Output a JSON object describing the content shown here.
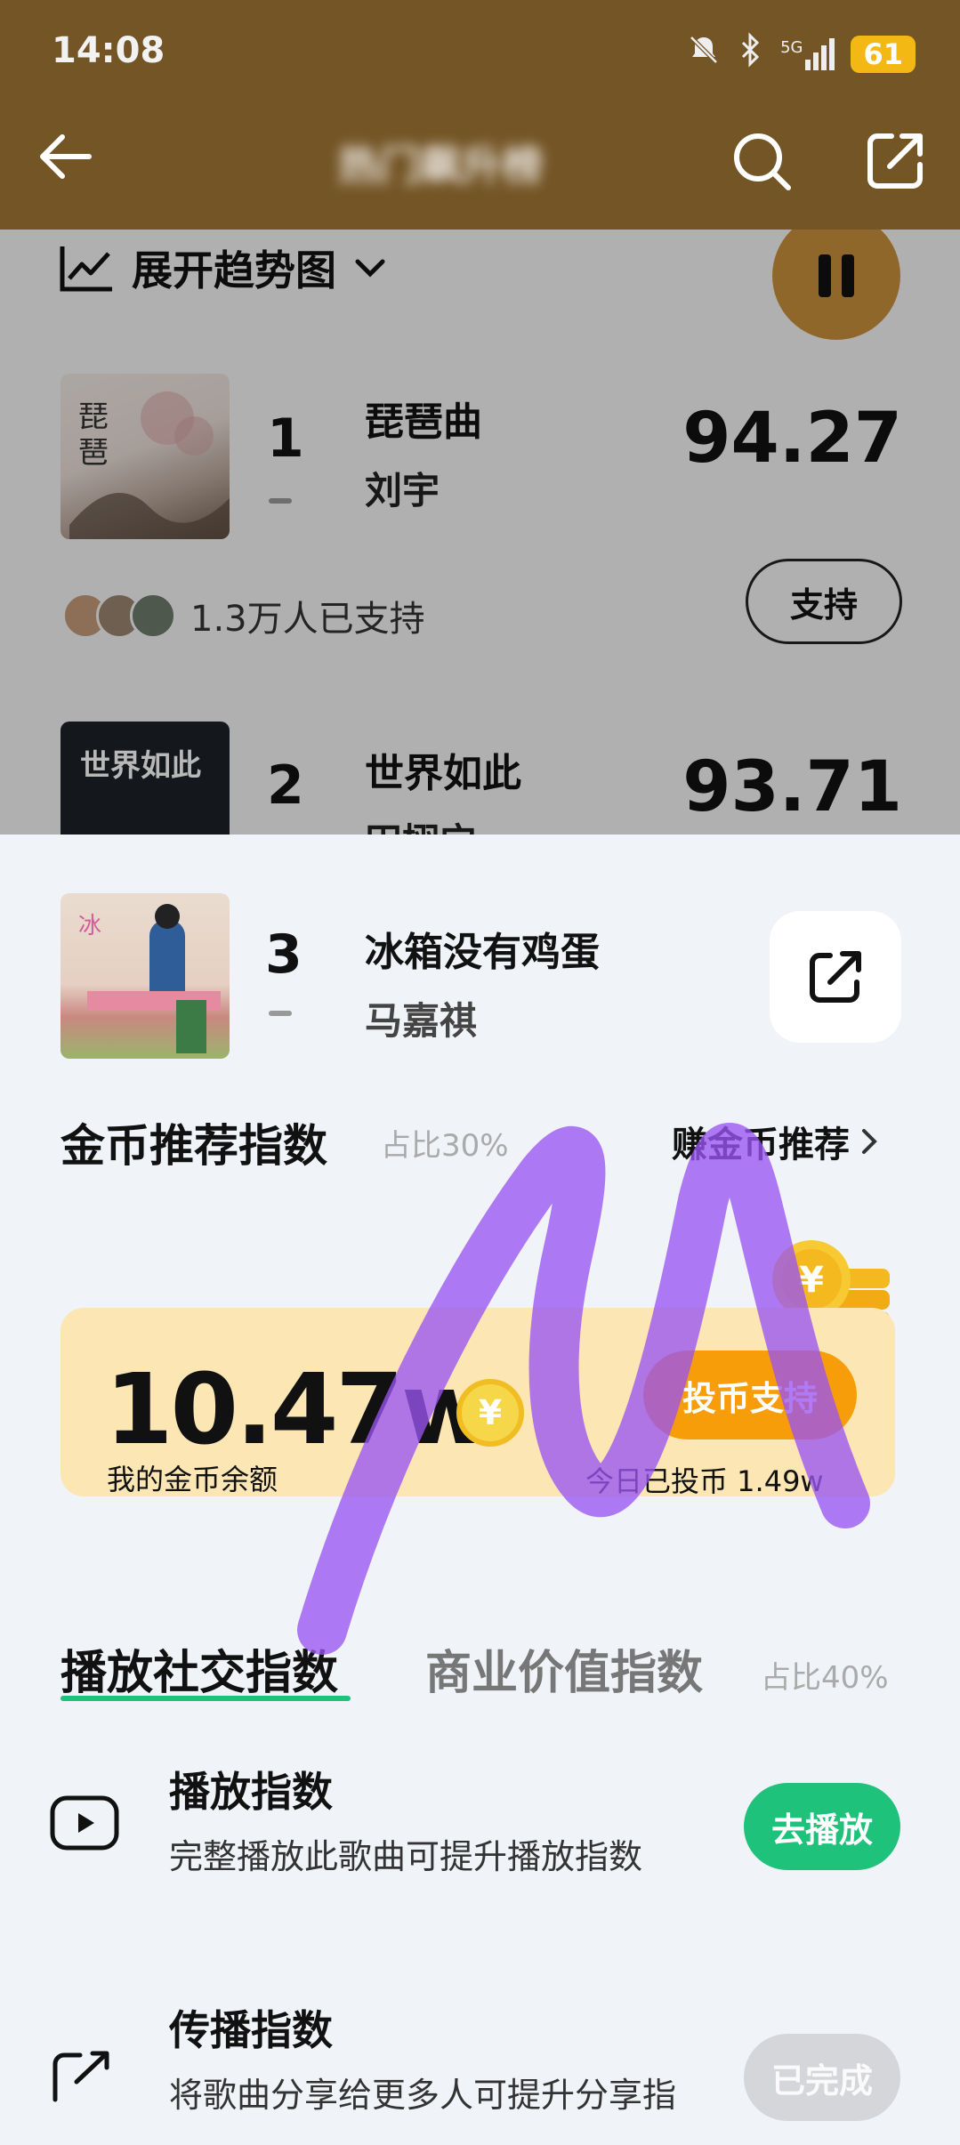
{
  "status_bar": {
    "time": "14:08",
    "network": "5G",
    "battery": "61"
  },
  "header": {
    "title": "热门飙升榜"
  },
  "trend": {
    "label": "展开趋势图"
  },
  "ranking": [
    {
      "rank": "1",
      "title": "琵琶曲",
      "artist": "刘宇",
      "score": "94.27",
      "supporters": "1.3万人已支持",
      "support_label": "支持"
    },
    {
      "rank": "2",
      "title": "世界如此",
      "artist": "田栩宁",
      "score": "93.71",
      "cover_text": "世界如此"
    }
  ],
  "current_song": {
    "rank": "3",
    "title": "冰箱没有鸡蛋",
    "artist": "马嘉祺"
  },
  "coin_section": {
    "title": "金币推荐指数",
    "share": "占比30%",
    "earn_link": "赚金币推荐",
    "balance_number": "10.47",
    "balance_unit": "w",
    "balance_label": "我的金币余额",
    "vote_button": "投币支持",
    "today": "今日已投币 1.49w"
  },
  "tabs": [
    {
      "label": "播放社交指数",
      "active": true
    },
    {
      "label": "商业价值指数",
      "active": false
    }
  ],
  "tab_share": "占比40%",
  "tasks": [
    {
      "title": "播放指数",
      "desc": "完整播放此歌曲可提升播放指数",
      "button": "去播放",
      "button_color": "#1ec27a"
    },
    {
      "title": "传播指数",
      "desc": "将歌曲分享给更多人可提升分享指",
      "button": "已完成",
      "button_color": "#d4d6da"
    }
  ],
  "colors": {
    "header_bg": "#745526",
    "accent_green": "#1ec27a",
    "coin_orange": "#f79d0a",
    "scribble": "#9a55f2"
  }
}
